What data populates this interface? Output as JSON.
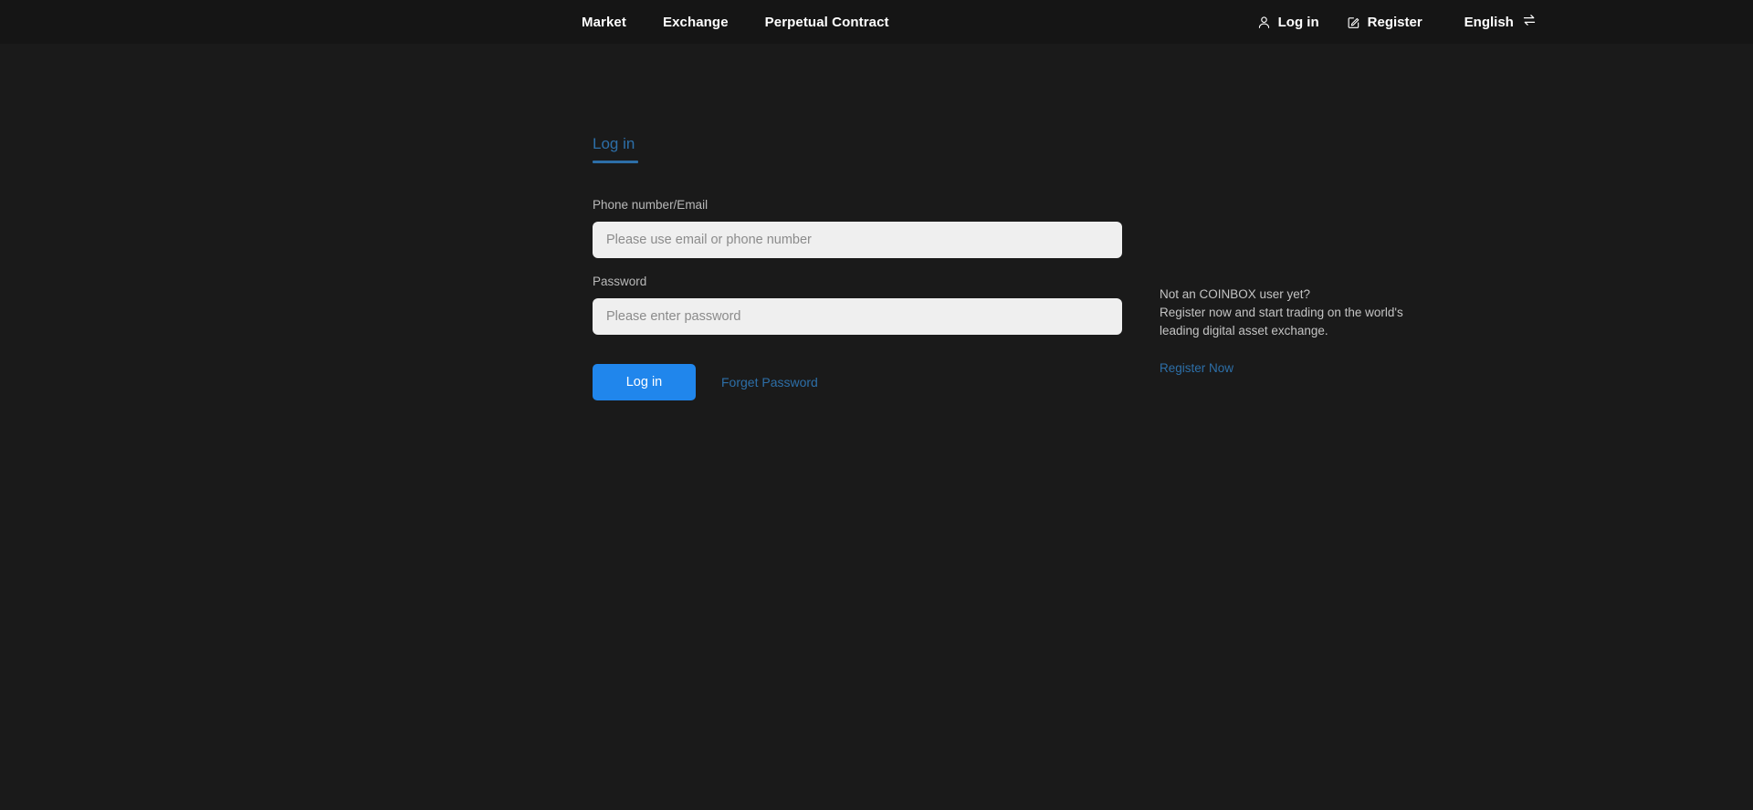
{
  "colors": {
    "page_background": "#1a1a1a",
    "header_background": "#151515",
    "accent_blue": "#2086ec",
    "link_blue": "#2d6fa8",
    "input_background": "#efefef"
  },
  "header": {
    "nav": [
      {
        "label": "Market",
        "icon": ""
      },
      {
        "label": "Exchange",
        "icon": ""
      },
      {
        "label": "Perpetual Contract",
        "icon": ""
      }
    ],
    "login": {
      "label": "Log in",
      "icon": "user-icon"
    },
    "register": {
      "label": "Register",
      "icon": "edit-square-icon"
    },
    "language": {
      "label": "English",
      "icon": "swap-arrows-icon"
    }
  },
  "login_form": {
    "tabs": [
      {
        "label": "Log in",
        "active": true
      }
    ],
    "account": {
      "label": "Phone number/Email",
      "placeholder": "Please use email or phone number",
      "value": ""
    },
    "password": {
      "label": "Password",
      "placeholder": "Please enter password",
      "value": ""
    },
    "submit_label": "Log in",
    "forget_password_label": "Forget Password"
  },
  "promo": {
    "line1": "Not an COINBOX user yet?",
    "line2": "Register now and start trading on the world's",
    "line3": "leading digital asset exchange.",
    "register_link_label": "Register Now"
  }
}
